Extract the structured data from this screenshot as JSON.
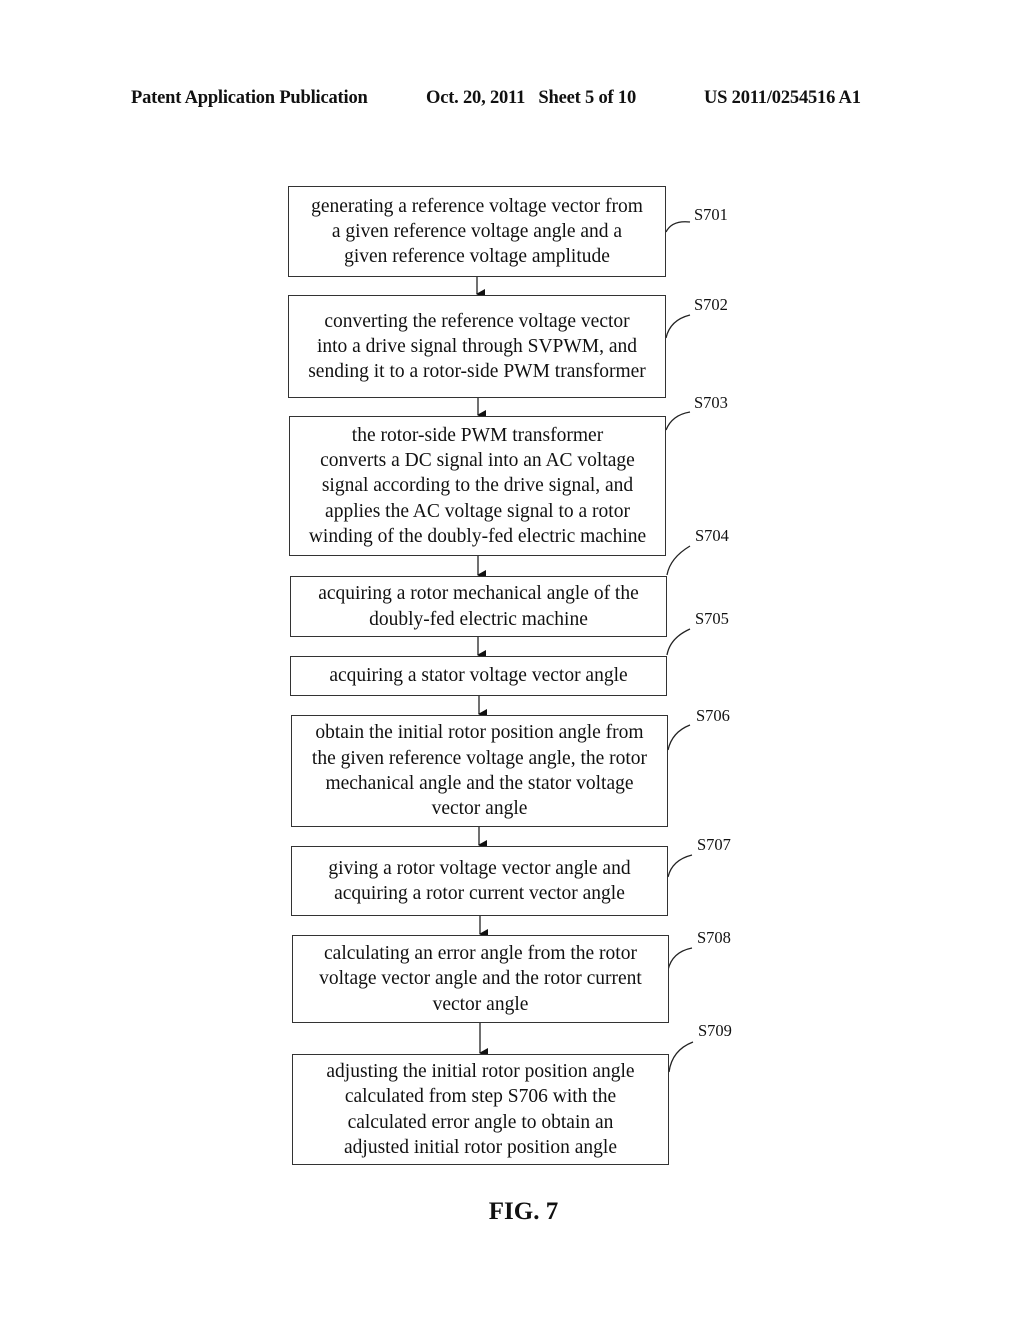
{
  "header": {
    "publication": "Patent Application Publication",
    "date_sheet": "Oct. 20, 2011   Sheet 5 of 10",
    "number": "US 2011/0254516 A1"
  },
  "steps": [
    {
      "id": "S701",
      "text": "generating a reference voltage vector from\na given reference voltage angle  and a\ngiven reference voltage amplitude"
    },
    {
      "id": "S702",
      "text": "converting the reference voltage vector\ninto a drive signal through SVPWM, and\nsending it to a rotor-side PWM transformer"
    },
    {
      "id": "S703",
      "text": "the rotor-side PWM transformer\nconverts a DC signal into an AC voltage\nsignal according to the drive signal, and\napplies the AC voltage signal to a rotor\nwinding of the doubly-fed electric machine"
    },
    {
      "id": "S704",
      "text": "acquiring a rotor mechanical angle of the\ndoubly-fed electric machine"
    },
    {
      "id": "S705",
      "text": "acquiring a stator voltage vector angle"
    },
    {
      "id": "S706",
      "text": "obtain the initial rotor position angle from\nthe given reference voltage angle, the rotor\nmechanical angle and the  stator voltage\nvector angle"
    },
    {
      "id": "S707",
      "text": "giving a rotor voltage vector angle  and\nacquiring a rotor current vector angle"
    },
    {
      "id": "S708",
      "text": "calculating an error angle  from the rotor\nvoltage vector angle  and the rotor current\nvector angle"
    },
    {
      "id": "S709",
      "text": "adjusting the initial rotor position angle\ncalculated from step S706 with the\ncalculated error angle  to obtain an\nadjusted initial rotor position angle"
    }
  ],
  "figure_caption": "FIG. 7"
}
